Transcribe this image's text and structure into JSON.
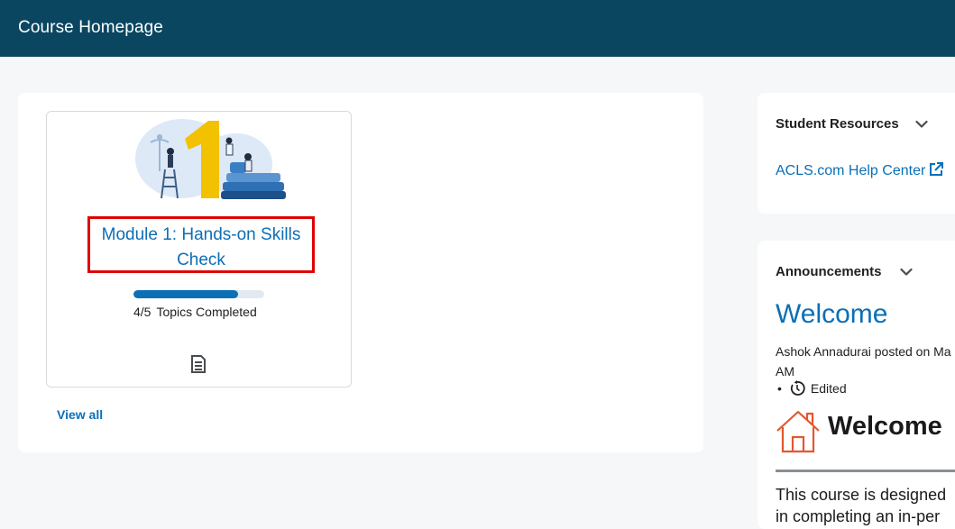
{
  "header": {
    "title": "Course Homepage"
  },
  "content_browser": {
    "module": {
      "title": "Module 1: Hands-on Skills Check",
      "illustration_icon": "module-1-illustration",
      "progress": {
        "completed": 4,
        "total": 5,
        "fraction": 0.8,
        "count_text": "4/5",
        "label": "Topics Completed"
      },
      "content_icon": "document-icon"
    },
    "view_all": "View all"
  },
  "student_resources": {
    "heading": "Student Resources",
    "link_label": "ACLS.com Help Center",
    "link_icon": "external-link-icon"
  },
  "announcements": {
    "heading": "Announcements",
    "title": "Welcome",
    "meta_line1": "Ashok Annadurai posted on Ma",
    "meta_line2": "AM",
    "edited_label": "Edited",
    "edited_bullet": "•",
    "welcome_heading": "Welcome",
    "body_line1": "This course is designed",
    "body_line2": "in completing an in-per"
  },
  "colors": {
    "header_bg": "#0b4661",
    "link": "#0a6fb7",
    "highlight_border": "#e00000",
    "house_icon": "#e4572e"
  }
}
